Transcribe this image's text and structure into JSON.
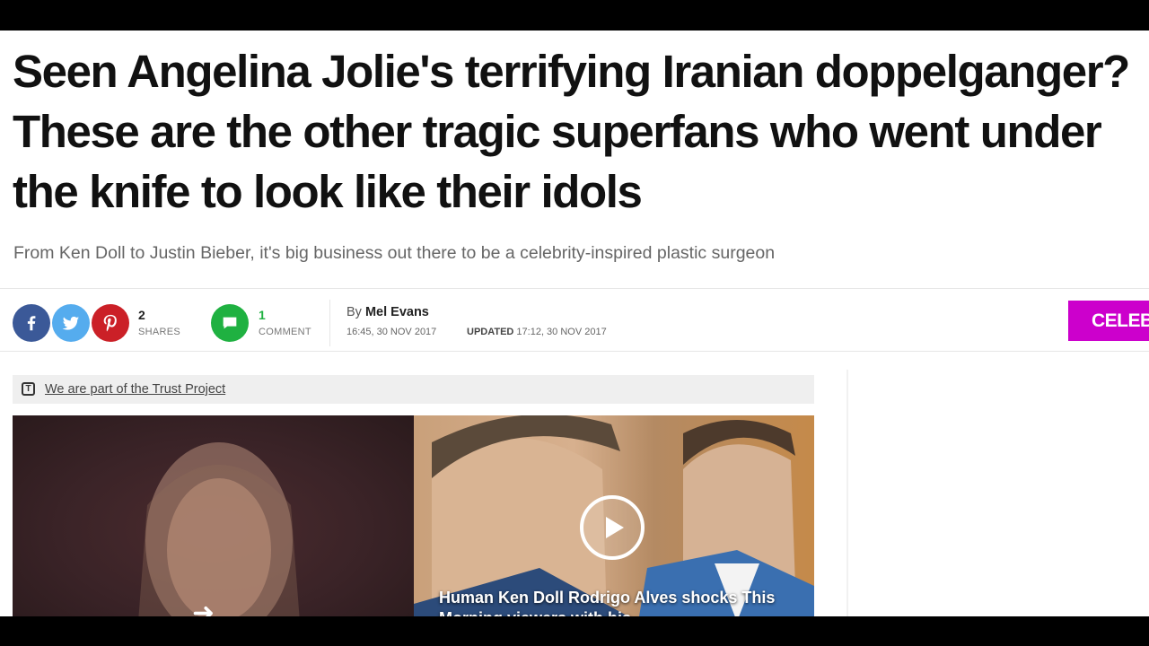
{
  "article": {
    "headline": "Seen Angelina Jolie's terrifying Iranian doppelganger? These are the other tragic superfans who went under the knife to look like their idols",
    "subheadline": "From Ken Doll to Justin Bieber, it's big business out there to be a celebrity-inspired plastic surgeon"
  },
  "share": {
    "facebook_icon": "facebook-icon",
    "twitter_icon": "twitter-icon",
    "pinterest_icon": "pinterest-icon",
    "shares_count": "2",
    "shares_label": "SHARES",
    "comment_icon": "comment-icon",
    "comments_count": "1",
    "comments_label": "COMMENT"
  },
  "byline": {
    "prefix": "By",
    "author": "Mel Evans",
    "published": "16:45, 30 NOV 2017",
    "updated_label": "UPDATED",
    "updated": "17:12, 30 NOV 2017"
  },
  "category_tag": "CELEBS",
  "trust": {
    "icon": "trust-project-icon",
    "link": "We are part of the Trust Project"
  },
  "video": {
    "caption": "Human Ken Doll Rodrigo Alves shocks This Morning viewers with his",
    "play_icon": "play-icon"
  },
  "colors": {
    "facebook": "#3b5998",
    "twitter": "#55acee",
    "pinterest": "#cb2027",
    "comment": "#1fb141",
    "tag": "#cc00cc"
  }
}
